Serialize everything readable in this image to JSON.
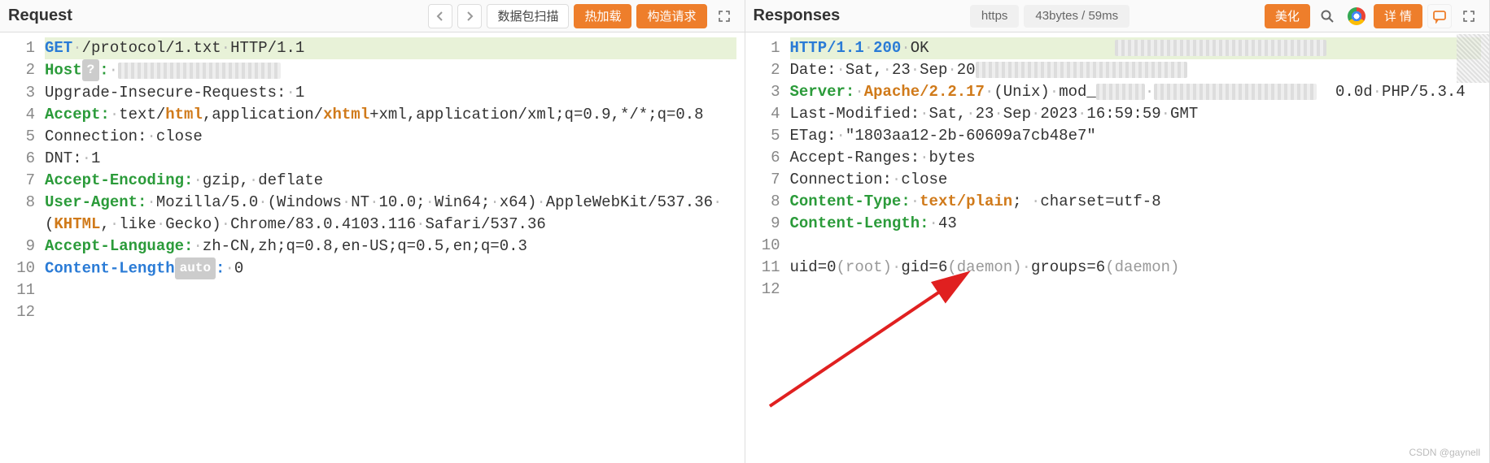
{
  "request": {
    "title": "Request",
    "buttons": {
      "scan": "数据包扫描",
      "hotload": "热加载",
      "build": "构造请求"
    },
    "lines": [
      {
        "n": 1,
        "hl": true,
        "segs": [
          [
            "kw-blue",
            "GET"
          ],
          [
            "dot",
            "·"
          ],
          [
            "",
            "/protocol/1.txt"
          ],
          [
            "dot",
            "·"
          ],
          [
            "",
            "HTTP/1.1"
          ]
        ]
      },
      {
        "n": 2,
        "segs": [
          [
            "kw-green",
            "Host"
          ],
          [
            "badge",
            "?"
          ],
          [
            "kw-green",
            ":"
          ],
          [
            "dot",
            "·"
          ],
          [
            "censor",
            "w200"
          ]
        ]
      },
      {
        "n": 3,
        "segs": [
          [
            "",
            "Upgrade-Insecure-Requests:"
          ],
          [
            "dot",
            "·"
          ],
          [
            "",
            "1"
          ]
        ]
      },
      {
        "n": 4,
        "segs": [
          [
            "kw-green",
            "Accept:"
          ],
          [
            "dot",
            "·"
          ],
          [
            "",
            "text/"
          ],
          [
            "kw-orange",
            "html"
          ],
          [
            "",
            ",application/"
          ],
          [
            "kw-orange",
            "xhtml"
          ],
          [
            "",
            "+xml,application/xml;q=0.9,*/*;q=0.8"
          ]
        ]
      },
      {
        "n": 5,
        "segs": [
          [
            "",
            "Connection:"
          ],
          [
            "dot",
            "·"
          ],
          [
            "",
            "close"
          ]
        ]
      },
      {
        "n": 6,
        "segs": [
          [
            "",
            "DNT:"
          ],
          [
            "dot",
            "·"
          ],
          [
            "",
            "1"
          ]
        ]
      },
      {
        "n": 7,
        "segs": [
          [
            "kw-green",
            "Accept-Encoding:"
          ],
          [
            "dot",
            "·"
          ],
          [
            "",
            "gzip,"
          ],
          [
            "dot",
            "·"
          ],
          [
            "",
            "deflate"
          ]
        ]
      },
      {
        "n": 8,
        "segs": [
          [
            "kw-green",
            "User-Agent:"
          ],
          [
            "dot",
            "·"
          ],
          [
            "",
            "Mozilla/5.0"
          ],
          [
            "dot",
            "·"
          ],
          [
            "",
            "(Windows"
          ],
          [
            "dot",
            "·"
          ],
          [
            "",
            "NT"
          ],
          [
            "dot",
            "·"
          ],
          [
            "",
            "10.0;"
          ],
          [
            "dot",
            "·"
          ],
          [
            "",
            "Win64;"
          ],
          [
            "dot",
            "·"
          ],
          [
            "",
            "x64)"
          ],
          [
            "dot",
            "·"
          ],
          [
            "",
            "AppleWebKit/537.36"
          ],
          [
            "dot",
            "·"
          ],
          [
            "",
            "("
          ],
          [
            "kw-orange",
            "KHTML"
          ],
          [
            "",
            ","
          ],
          [
            "dot",
            "·"
          ],
          [
            "",
            "like"
          ],
          [
            "dot",
            "·"
          ],
          [
            "",
            "Gecko)"
          ],
          [
            "dot",
            "·"
          ],
          [
            "",
            "Chrome/83.0.4103.116"
          ],
          [
            "dot",
            "·"
          ],
          [
            "",
            "Safari/537.36"
          ]
        ]
      },
      {
        "n": 9,
        "segs": [
          [
            "kw-green",
            "Accept-Language:"
          ],
          [
            "dot",
            "·"
          ],
          [
            "",
            "zh-CN,zh;q=0.8,en-US;q=0.5,en;q=0.3"
          ]
        ]
      },
      {
        "n": 10,
        "segs": [
          [
            "kw-blue",
            "Content-Length"
          ],
          [
            "badge",
            "auto"
          ],
          [
            "kw-blue",
            ":"
          ],
          [
            "dot",
            "·"
          ],
          [
            "",
            "0"
          ]
        ]
      },
      {
        "n": 11,
        "segs": []
      },
      {
        "n": 12,
        "segs": []
      }
    ]
  },
  "response": {
    "title": "Responses",
    "tags": {
      "proto": "https",
      "timing": "43bytes / 59ms"
    },
    "buttons": {
      "beautify": "美化",
      "details": "详 情"
    },
    "lines": [
      {
        "n": 1,
        "hl": true,
        "segs": [
          [
            "kw-blue",
            "HTTP/1.1"
          ],
          [
            "dot",
            "·"
          ],
          [
            "kw-blue",
            "200"
          ],
          [
            "dot",
            "·"
          ],
          [
            "",
            "OK"
          ],
          [
            "",
            "                    "
          ],
          [
            "censor",
            "w260"
          ]
        ]
      },
      {
        "n": 2,
        "segs": [
          [
            "",
            "Date:"
          ],
          [
            "dot",
            "·"
          ],
          [
            "",
            "Sat,"
          ],
          [
            "dot",
            "·"
          ],
          [
            "",
            "23"
          ],
          [
            "dot",
            "·"
          ],
          [
            "",
            "Sep"
          ],
          [
            "dot",
            "·"
          ],
          [
            "",
            "20"
          ],
          [
            "censor",
            "w260"
          ]
        ]
      },
      {
        "n": 3,
        "segs": [
          [
            "kw-green",
            "Server:"
          ],
          [
            "dot",
            "·"
          ],
          [
            "kw-orange",
            "Apache/2.2.17"
          ],
          [
            "dot",
            "·"
          ],
          [
            "",
            "(Unix)"
          ],
          [
            "dot",
            "·"
          ],
          [
            "",
            "mod_"
          ],
          [
            "censor",
            "w60"
          ],
          [
            "dot",
            "·"
          ],
          [
            "censor",
            "w200"
          ],
          [
            "",
            "  0.0d"
          ],
          [
            "dot",
            "·"
          ],
          [
            "",
            "PHP/5.3.4"
          ]
        ]
      },
      {
        "n": 4,
        "segs": [
          [
            "",
            "Last-Modified:"
          ],
          [
            "dot",
            "·"
          ],
          [
            "",
            "Sat,"
          ],
          [
            "dot",
            "·"
          ],
          [
            "",
            "23"
          ],
          [
            "dot",
            "·"
          ],
          [
            "",
            "Sep"
          ],
          [
            "dot",
            "·"
          ],
          [
            "",
            "2023"
          ],
          [
            "dot",
            "·"
          ],
          [
            "",
            "16:59:59"
          ],
          [
            "dot",
            "·"
          ],
          [
            "",
            "GMT"
          ]
        ]
      },
      {
        "n": 5,
        "segs": [
          [
            "",
            "ETag:"
          ],
          [
            "dot",
            "·"
          ],
          [
            "",
            "\"1803aa12-2b-60609a7cb48e7\""
          ]
        ]
      },
      {
        "n": 6,
        "segs": [
          [
            "",
            "Accept-Ranges:"
          ],
          [
            "dot",
            "·"
          ],
          [
            "",
            "bytes"
          ]
        ]
      },
      {
        "n": 7,
        "segs": [
          [
            "",
            "Connection:"
          ],
          [
            "dot",
            "·"
          ],
          [
            "",
            "close"
          ]
        ]
      },
      {
        "n": 8,
        "segs": [
          [
            "kw-green",
            "Content-Type:"
          ],
          [
            "dot",
            "·"
          ],
          [
            "kw-orange",
            "text/plain"
          ],
          [
            "",
            "; "
          ],
          [
            "dot",
            "·"
          ],
          [
            "",
            "charset=utf-8"
          ]
        ]
      },
      {
        "n": 9,
        "segs": [
          [
            "kw-green",
            "Content-Length:"
          ],
          [
            "dot",
            "·"
          ],
          [
            "",
            "43"
          ]
        ]
      },
      {
        "n": 10,
        "segs": []
      },
      {
        "n": 11,
        "segs": [
          [
            "",
            "uid=0"
          ],
          [
            "dim",
            "(root)"
          ],
          [
            "dot",
            "·"
          ],
          [
            "",
            "gid=6"
          ],
          [
            "dim",
            "(daemon)"
          ],
          [
            "dot",
            "·"
          ],
          [
            "",
            "groups=6"
          ],
          [
            "dim",
            "(daemon)"
          ]
        ]
      },
      {
        "n": 12,
        "segs": []
      }
    ]
  },
  "watermark": "CSDN @gaynell"
}
